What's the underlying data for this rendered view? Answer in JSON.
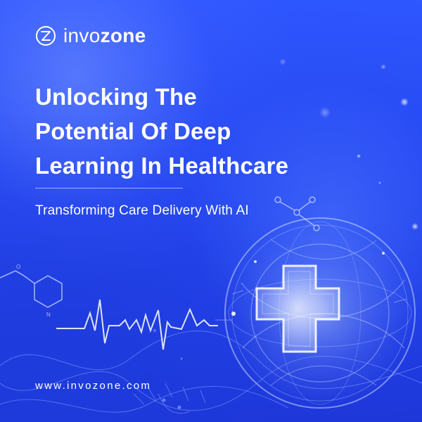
{
  "brand": {
    "logo_light": "invo",
    "logo_bold": "zone",
    "logo_icon": "invozone-logo-icon",
    "website": "www.invozone.com"
  },
  "hero": {
    "title_lines": [
      "Unlocking The",
      "Potential Of Deep",
      "Learning In Healthcare"
    ],
    "subtitle": "Transforming Care Delivery With AI"
  },
  "decor": {
    "icons": [
      "molecule-icon",
      "heartbeat-line-icon",
      "medical-cross-icon",
      "sphere-icon",
      "network-node-icon"
    ]
  },
  "colors": {
    "background": "#2446f0",
    "text": "#ffffff",
    "accent": "#9fb0ff"
  }
}
